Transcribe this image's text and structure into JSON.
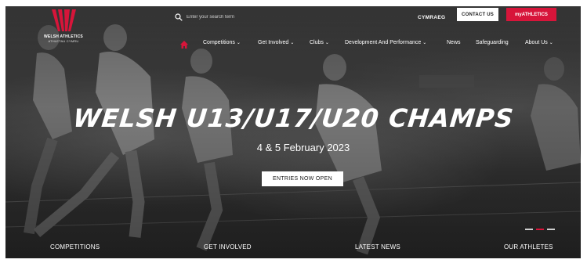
{
  "logo": {
    "name": "WELSH ATHLETICS",
    "sub": "ATHLETAU CYMRU",
    "color": "#d7153a"
  },
  "search": {
    "placeholder": "Enter your search term"
  },
  "top_links": {
    "language": "CYMRAEG",
    "contact": "CONTACT US",
    "myathletics": "myATHLETICS"
  },
  "nav": {
    "home_icon": "home-icon",
    "items": [
      {
        "label": "Competitions",
        "dropdown": "⌄"
      },
      {
        "label": "Get Involved",
        "dropdown": "⌄"
      },
      {
        "label": "Clubs",
        "dropdown": "⌄"
      },
      {
        "label": "Development And Performance",
        "dropdown": "⌄"
      },
      {
        "label": "News"
      },
      {
        "label": "Safeguarding"
      },
      {
        "label": "About Us",
        "dropdown": "⌄"
      }
    ]
  },
  "hero": {
    "title": "WELSH U13/U17/U20 CHAMPS",
    "date": "4 & 5 February 2023",
    "cta": "ENTRIES NOW OPEN",
    "slides_total": 3,
    "slide_active": 2
  },
  "bottom_nav": [
    "COMPETITIONS",
    "GET INVOLVED",
    "LATEST NEWS",
    "OUR ATHLETES"
  ],
  "colors": {
    "brand_red": "#d7153a",
    "white": "#ffffff"
  }
}
